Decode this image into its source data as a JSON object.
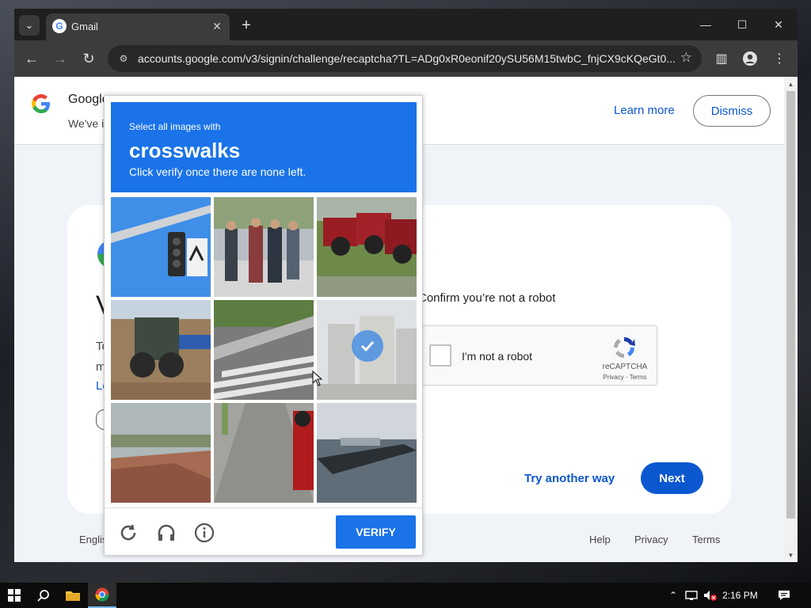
{
  "browser": {
    "tab_title": "Gmail",
    "url": "accounts.google.com/v3/signin/challenge/recaptcha?TL=ADg0xR0eonif20ySU56M15twbC_fnjCX9cKQeGt0..."
  },
  "page": {
    "banner": {
      "title": "Google",
      "text": "We've i",
      "learn_more": "Learn more",
      "dismiss": "Dismiss"
    },
    "card": {
      "heading": "V",
      "text1": "To",
      "text2": "m",
      "link": "Le",
      "confirm_text": "Confirm you’re not a robot",
      "try_another": "Try another way",
      "next": "Next"
    },
    "recaptcha_widget": {
      "label": "I'm not a robot",
      "brand": "reCAPTCHA",
      "terms": "Privacy - Terms"
    },
    "footer": {
      "language": "Englis",
      "help": "Help",
      "privacy": "Privacy",
      "terms": "Terms"
    }
  },
  "challenge": {
    "line1": "Select all images with",
    "keyword": "crosswalks",
    "line3": "Click verify once there are none left.",
    "verify": "VERIFY",
    "tiles": [
      {
        "subject": "traffic-light",
        "selected": false
      },
      {
        "subject": "pedestrians",
        "selected": false
      },
      {
        "subject": "red-tractors",
        "selected": false
      },
      {
        "subject": "tractor-field",
        "selected": false
      },
      {
        "subject": "crosswalk",
        "selected": false
      },
      {
        "subject": "building",
        "selected": true
      },
      {
        "subject": "rooftop",
        "selected": false
      },
      {
        "subject": "sidewalk-motorcycle",
        "selected": false
      },
      {
        "subject": "boat",
        "selected": false
      }
    ]
  },
  "taskbar": {
    "time": "2:16 PM"
  },
  "colors": {
    "google_blue": "#0b57d0",
    "recaptcha_blue": "#1a73e8"
  }
}
